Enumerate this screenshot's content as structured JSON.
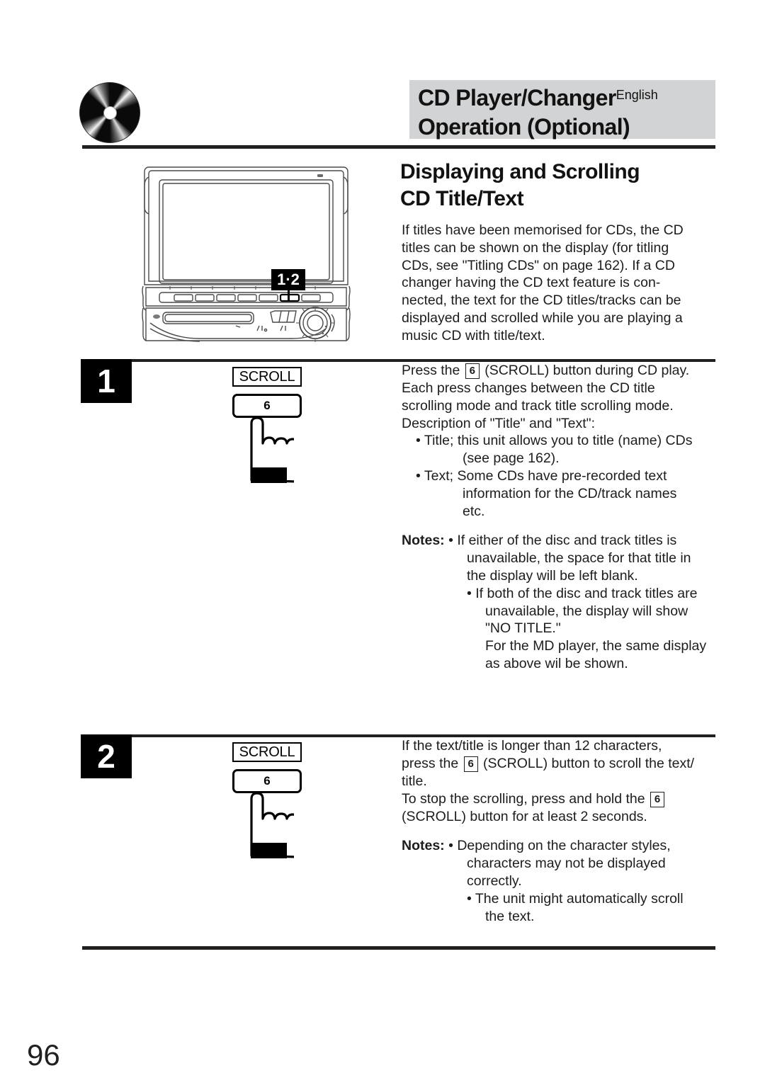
{
  "header": {
    "title_line1": "CD Player/Changer",
    "title_line2": "Operation (Optional)",
    "language": "English",
    "band_color": "#d2d3d4"
  },
  "section": {
    "heading_line1": "Displaying and Scrolling",
    "heading_line2": "CD Title/Text"
  },
  "intro": {
    "lines": [
      "If titles have been memorised for CDs, the CD",
      "titles can be shown on the display (for titling",
      "CDs, see \"Titling CDs\" on page 162). If a CD",
      "changer having the CD text feature is con-",
      "nected, the text for the CD titles/tracks can be",
      "displayed and scrolled while you are playing a",
      "music CD with title/text."
    ]
  },
  "device": {
    "callout_label": "1·2",
    "button_count": 7,
    "highlighted_button_index": 6
  },
  "steps": [
    {
      "number": "1",
      "illustration": {
        "label": "SCROLL",
        "key": "6",
        "hand_icon": "pointing-hand-icon"
      },
      "lines": [
        {
          "text_before": "Press the ",
          "key": "6",
          "text_after": " (SCROLL) button during CD play."
        },
        {
          "text_before": "Each press changes between the CD title"
        },
        {
          "text_before": "scrolling mode and track title scrolling mode."
        },
        {
          "text_before": "Description of \"Title\" and \"Text\":"
        }
      ],
      "bullets": [
        {
          "indent": 1,
          "text": "• Title; this unit allows you to title (name) CDs"
        },
        {
          "indent": 2,
          "text": "(see page 162)."
        },
        {
          "indent": 1,
          "text": "• Text; Some CDs have pre-recorded text"
        },
        {
          "indent": 2,
          "text": "information for the CD/track names"
        },
        {
          "indent": 2,
          "text": "etc."
        }
      ],
      "notes": {
        "label": "Notes:",
        "items": [
          "• If either of the disc and track titles is",
          "unavailable, the space for that title in",
          "the display will be left blank.",
          "• If both of the disc and track titles are",
          "unavailable, the display will show",
          "\"NO TITLE.\"",
          "For the MD player, the same display",
          "as above wil be shown."
        ]
      }
    },
    {
      "number": "2",
      "illustration": {
        "label": "SCROLL",
        "key": "6",
        "hand_icon": "pointing-hand-icon"
      },
      "lines": [
        {
          "text_before": "If the text/title is longer than 12 characters,"
        },
        {
          "text_before": "press the ",
          "key": "6",
          "text_after": " (SCROLL) button to scroll the text/"
        },
        {
          "text_before": "title."
        },
        {
          "text_before": "To stop the scrolling, press and hold the ",
          "key": "6",
          "text_after": ""
        },
        {
          "text_before": "(SCROLL) button for at least 2 seconds."
        }
      ],
      "notes": {
        "label": "Notes:",
        "items": [
          "• Depending on the character styles,",
          "characters may not be displayed",
          "correctly.",
          "• The unit might automatically scroll",
          "the text."
        ]
      }
    }
  ],
  "footer": {
    "page_number": "96"
  }
}
